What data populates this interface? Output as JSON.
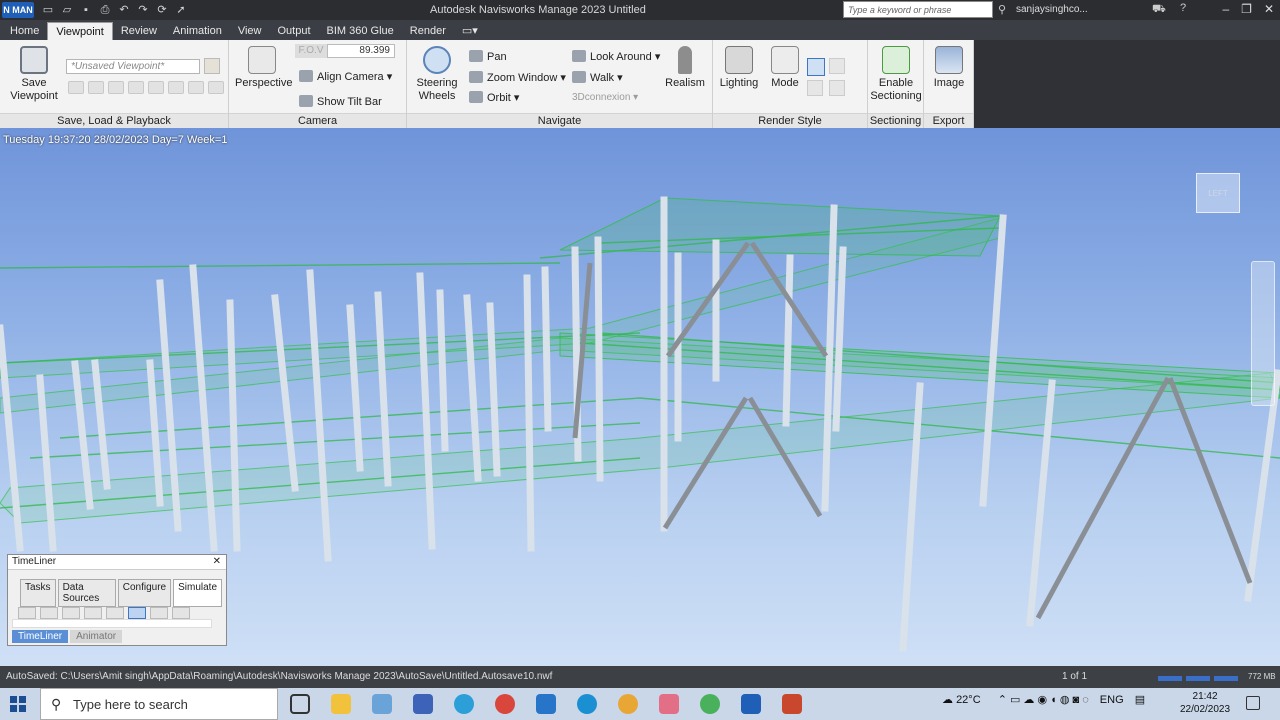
{
  "titlebar": {
    "logo": "N MAN",
    "title": "Autodesk Navisworks Manage 2023   Untitled",
    "search_placeholder": "Type a keyword or phrase",
    "user": "sanjaysinghco...",
    "icons": [
      "new-icon",
      "open-icon",
      "save-icon",
      "print-icon",
      "undo-icon",
      "redo-icon",
      "refresh-icon",
      "select-icon"
    ]
  },
  "tabs": [
    "Home",
    "Viewpoint",
    "Review",
    "Animation",
    "View",
    "Output",
    "BIM 360 Glue",
    "Render"
  ],
  "ribbon": {
    "save_viewpoint": "Save\nViewpoint",
    "viewpoint_combo": "*Unsaved Viewpoint*",
    "panel_save": "Save, Load & Playback",
    "perspective": "Perspective",
    "fov_label": "F.O.V",
    "fov_value": "89.399",
    "align_camera": "Align Camera",
    "show_tilt": "Show Tilt Bar",
    "panel_camera": "Camera",
    "steering": "Steering\nWheels",
    "pan": "Pan",
    "zoom_window": "Zoom Window",
    "orbit": "Orbit",
    "look_around": "Look Around",
    "walk": "Walk",
    "connexion": "3Dconnexion",
    "realism": "Realism",
    "panel_navigate": "Navigate",
    "lighting": "Lighting",
    "mode": "Mode",
    "panel_render": "Render Style",
    "enable_sectioning": "Enable\nSectioning",
    "panel_sectioning": "Sectioning",
    "image": "Image",
    "panel_export": "Export"
  },
  "viewport": {
    "dateline": "Tuesday 19:37:20 28/02/2023 Day=7 Week=1",
    "viewcube": "LEFT"
  },
  "timeliner": {
    "title": "TimeLiner",
    "tabs": [
      "Tasks",
      "Data Sources",
      "Configure",
      "Simulate"
    ],
    "bottom_tabs": [
      "TimeLiner",
      "Animator"
    ]
  },
  "status": {
    "text": "AutoSaved: C:\\Users\\Amit singh\\AppData\\Roaming\\Autodesk\\Navisworks Manage 2023\\AutoSave\\Untitled.Autosave10.nwf",
    "page": "1 of 1",
    "memory": "772 MB"
  },
  "taskbar": {
    "search": "Type here to search",
    "temp": "22°C",
    "lang": "ENG",
    "time": "21:42",
    "date": "22/02/2023"
  },
  "colors": {
    "title_bg": "#2b2d31",
    "ribbon_bg": "#f3f3f3",
    "sky_top": "#6f94d9",
    "slab_green": "#2fc24a"
  }
}
